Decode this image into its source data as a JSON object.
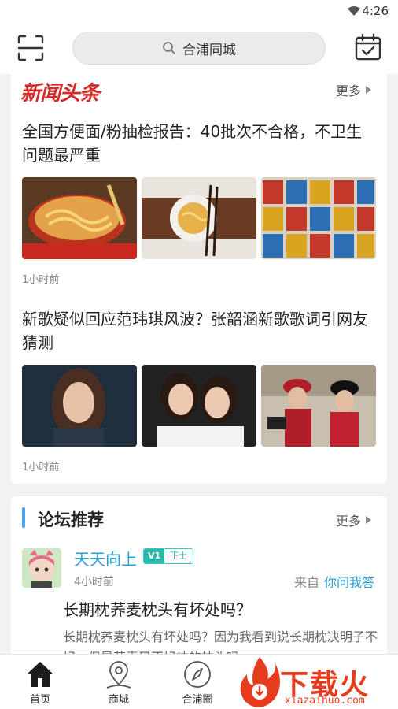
{
  "status_bar": {
    "time": "4:26"
  },
  "search": {
    "placeholder": "合浦同城"
  },
  "news": {
    "logo": "新闻头条",
    "more_label": "更多",
    "articles": [
      {
        "title": "全国方便面/粉抽检报告：40批次不合格，不卫生问题最严重",
        "time": "1小时前"
      },
      {
        "title": "新歌疑似回应范玮琪风波？张韶涵新歌歌词引网友猜测",
        "time": "1小时前"
      }
    ]
  },
  "forum": {
    "title": "论坛推荐",
    "more_label": "更多",
    "post": {
      "username": "天天向上",
      "badge_v": "V1",
      "badge_level": "下士",
      "time": "4小时前",
      "from_label": "来自",
      "from_source": "你问我答",
      "title": "长期枕荞麦枕头有坏处吗？",
      "excerpt": "长期枕荞麦枕头有坏处吗？因为我看到说长期枕决明子不好，但是荞麦又不好枕的枕头吗"
    }
  },
  "tabs": [
    {
      "label": "首页",
      "icon": "home-icon"
    },
    {
      "label": "商城",
      "icon": "location-icon"
    },
    {
      "label": "合浦圈",
      "icon": "compass-icon"
    }
  ],
  "watermark": {
    "text": "下载火",
    "url_text": "xiazaihuo.com"
  },
  "colors": {
    "accent": "#2a9fd6",
    "news_red": "#d42b2b",
    "forum_bar": "#4aa3f0"
  }
}
